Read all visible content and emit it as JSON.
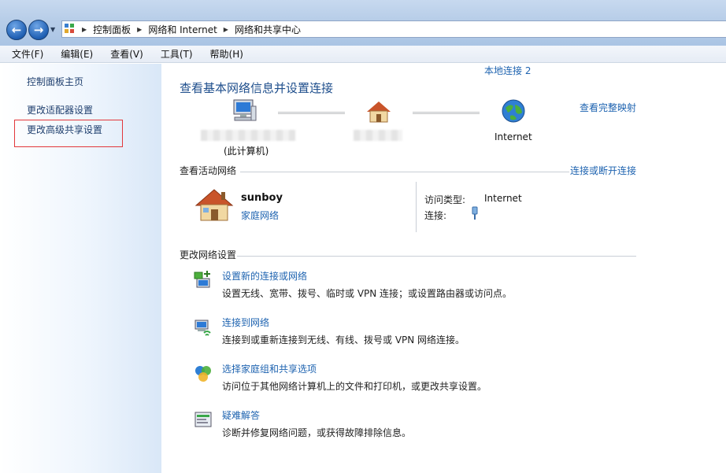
{
  "address": {
    "crumbs": [
      "控制面板",
      "网络和 Internet",
      "网络和共享中心"
    ],
    "icon": "control-panel-icon"
  },
  "menu": [
    "文件(F)",
    "编辑(E)",
    "查看(V)",
    "工具(T)",
    "帮助(H)"
  ],
  "sidebar": {
    "items": [
      {
        "label": "控制面板主页"
      },
      {
        "label": "更改适配器设置"
      },
      {
        "label": "更改高级共享设置"
      }
    ],
    "highlight_color": "#e2373b"
  },
  "main": {
    "title": "查看基本网络信息并设置连接",
    "full_map_link": "查看完整映射",
    "map": {
      "this_computer_label": "(此计算机)",
      "internet_label": "Internet"
    },
    "active": {
      "heading": "查看活动网络",
      "connect_link": "连接或断开连接",
      "network_name": "sunboy",
      "network_type": "家庭网络",
      "access_type_label": "访问类型:",
      "access_type_value": "Internet",
      "connection_label": "连接:",
      "connection_value": "本地连接 2"
    },
    "change": {
      "heading": "更改网络设置",
      "tasks": [
        {
          "title": "设置新的连接或网络",
          "desc": "设置无线、宽带、拨号、临时或 VPN 连接；或设置路由器或访问点。",
          "icon": "new-connection-icon"
        },
        {
          "title": "连接到网络",
          "desc": "连接到或重新连接到无线、有线、拨号或 VPN 网络连接。",
          "icon": "connect-network-icon"
        },
        {
          "title": "选择家庭组和共享选项",
          "desc": "访问位于其他网络计算机上的文件和打印机，或更改共享设置。",
          "icon": "homegroup-icon"
        },
        {
          "title": "疑难解答",
          "desc": "诊断并修复网络问题，或获得故障排除信息。",
          "icon": "troubleshoot-icon"
        }
      ]
    }
  },
  "colors": {
    "link": "#1e63b0",
    "title": "#1e4e8c"
  }
}
